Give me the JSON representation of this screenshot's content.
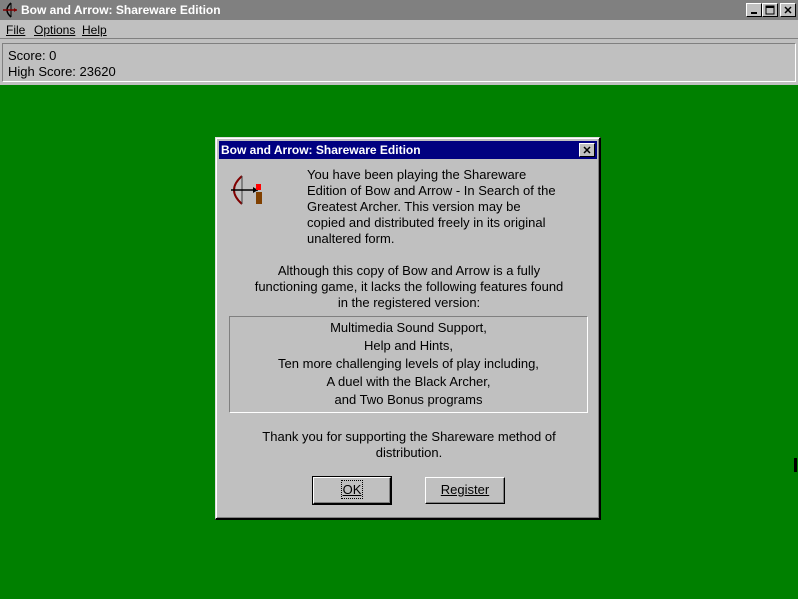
{
  "window": {
    "title": "Bow and Arrow: Shareware Edition"
  },
  "menu": {
    "items": [
      {
        "label": "File"
      },
      {
        "label": "Options"
      },
      {
        "label": "Help"
      }
    ]
  },
  "score": {
    "score_text": "Score: 0",
    "high_score_text": "High Score: 23620"
  },
  "dialog": {
    "title": "Bow and Arrow: Shareware Edition",
    "paragraph1": "You have been playing the Shareware\nEdition of Bow and Arrow - In Search of the\nGreatest Archer.  This version may be\ncopied and distributed freely in its original\nunaltered form.",
    "paragraph2": "Although this copy of Bow and Arrow is a fully\nfunctioning game, it lacks the following features found\nin the registered version:",
    "features": [
      "Multimedia Sound Support,",
      "Help and Hints,",
      "Ten more challenging levels of play including,",
      "A duel with the Black Archer,",
      "and Two Bonus programs"
    ],
    "paragraph3": "Thank you for supporting the Shareware method of\ndistribution.",
    "ok_label": "OK",
    "register_label": "Register"
  },
  "colors": {
    "field_green": "#008000",
    "dialog_title_blue": "#000080",
    "inactive_title_gray": "#808080",
    "window_gray": "#c0c0c0"
  }
}
